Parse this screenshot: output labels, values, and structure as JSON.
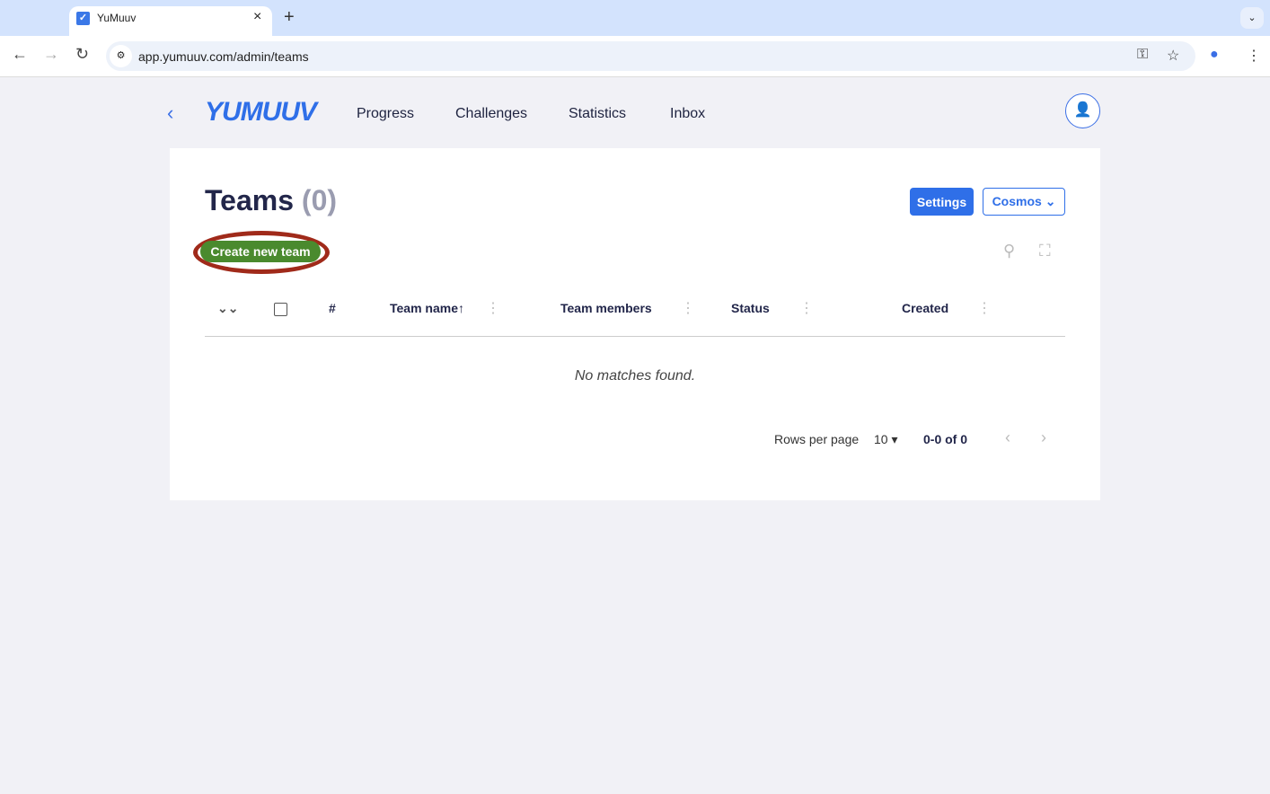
{
  "browser": {
    "tab_title": "YuMuuv",
    "url": "app.yumuuv.com/admin/teams"
  },
  "header": {
    "logo": "YUMUUV",
    "nav": [
      "Progress",
      "Challenges",
      "Statistics",
      "Inbox"
    ]
  },
  "page": {
    "title": "Teams",
    "count": "(0)",
    "settings_label": "Settings",
    "org_select": "Cosmos",
    "create_label": "Create new team"
  },
  "table": {
    "columns": [
      "#",
      "Team name",
      "Team members",
      "Status",
      "Created"
    ],
    "sort_indicator": "↑",
    "empty": "No matches found."
  },
  "pagination": {
    "rows_label": "Rows per page",
    "rows_value": "10",
    "range": "0-0 of 0"
  },
  "colors": {
    "accent": "#2f6fe8",
    "create_button": "#4a8a2e",
    "highlight_ring": "#a02a1a"
  }
}
